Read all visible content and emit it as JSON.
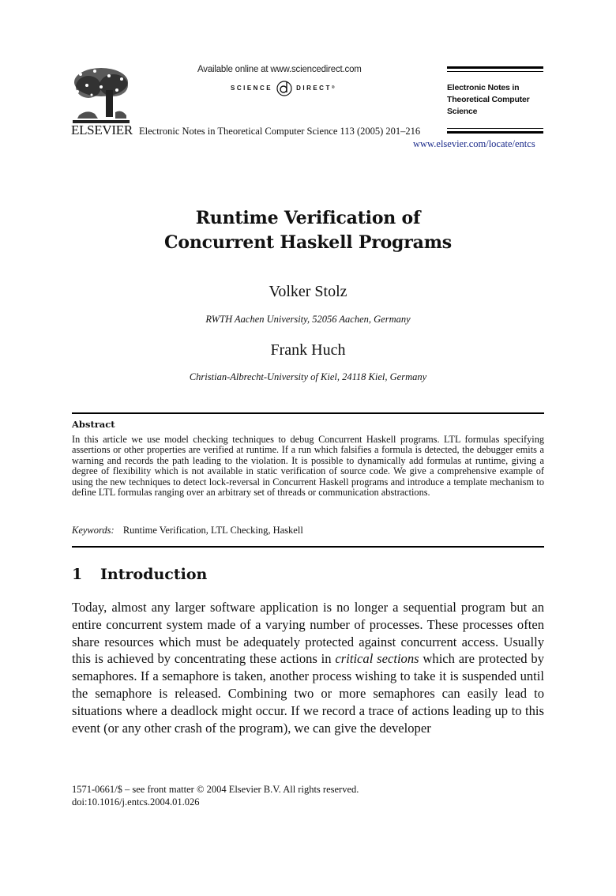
{
  "header": {
    "publisher_wordmark": "ELSEVIER",
    "publisher_logo_icon": "elsevier-tree-icon",
    "available_online": "Available online at www.sciencedirect.com",
    "sciencedirect_left": "SCIENCE",
    "sciencedirect_right": "DIRECT",
    "sciencedirect_mark": "®",
    "sciencedirect_icon": "sciencedirect-d-icon",
    "journal_citation": "Electronic Notes in Theoretical Computer Science 113 (2005) 201–216",
    "journal_name_lines": [
      "Electronic Notes in",
      "Theoretical Computer",
      "Science"
    ],
    "journal_url": "www.elsevier.com/locate/entcs",
    "link_color": "#1a2a8a"
  },
  "paper": {
    "title_lines": [
      "Runtime Verification of",
      "Concurrent Haskell Programs"
    ],
    "authors": [
      {
        "name": "Volker Stolz",
        "affiliation": "RWTH Aachen University, 52056 Aachen, Germany"
      },
      {
        "name": "Frank Huch",
        "affiliation": "Christian-Albrecht-University of Kiel, 24118 Kiel, Germany"
      }
    ],
    "abstract": {
      "heading": "Abstract",
      "text": "In this article we use model checking techniques to debug Concurrent Haskell programs.  LTL formulas specifying assertions or other properties are verified at runtime. If a run which falsifies a formula is detected, the debugger emits a warning and records the path leading to the violation. It is possible to dynamically add formulas at runtime, giving a degree of flexibility which is not available in static verification of source code. We give a comprehensive example of using the new techniques to detect lock-reversal in Concurrent Haskell programs and introduce a template mechanism to define LTL formulas ranging over an arbitrary set of threads or communication abstractions."
    },
    "keywords": {
      "label": "Keywords:",
      "value": "Runtime Verification, LTL Checking, Haskell"
    },
    "section": {
      "number": "1",
      "title": "Introduction",
      "text_before_em": "Today, almost any larger software application is no longer a sequential program but an entire concurrent system made of a varying number of processes.  These processes often share resources which must be adequately protected against concurrent access.  Usually this is achieved by concentrating these actions in ",
      "emphasis": "critical sections",
      "text_after_em": " which are protected by semaphores.  If a semaphore is taken, another process wishing to take it is suspended until the semaphore is released.  Combining two or more semaphores can easily lead to situations where a deadlock might occur.  If we record a trace of actions leading up to this event (or any other crash of the program), we can give the developer"
    }
  },
  "footer": {
    "line1": "1571-0661/$ – see front matter © 2004 Elsevier B.V. All rights reserved.",
    "line2": "doi:10.1016/j.entcs.2004.01.026"
  }
}
